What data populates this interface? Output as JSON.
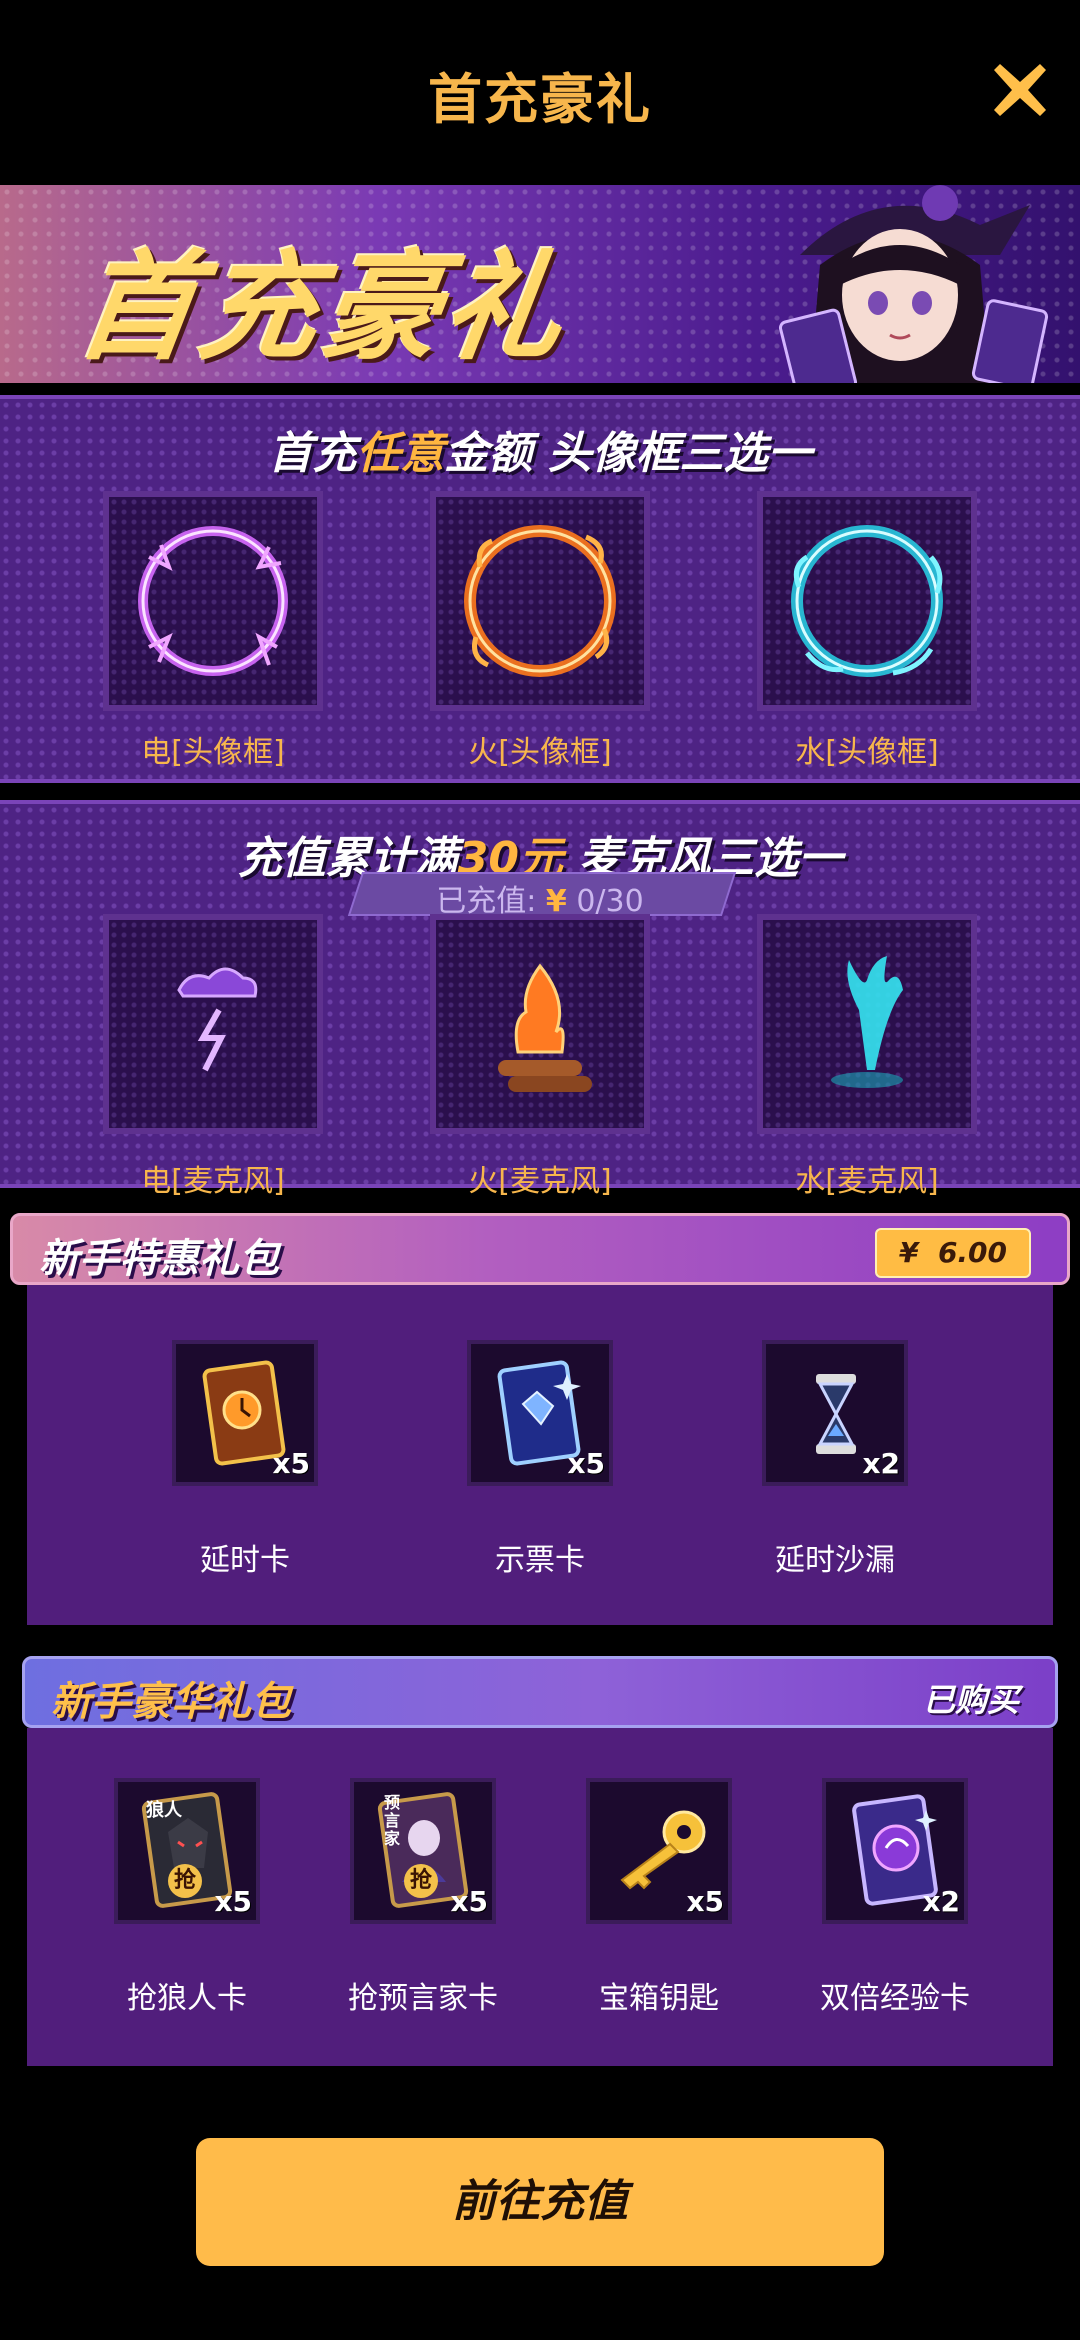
{
  "header": {
    "title": "首充豪礼"
  },
  "banner": {
    "title": "首充豪礼"
  },
  "section1": {
    "title_pre": "首充",
    "title_hl": "任意",
    "title_post": "金额  头像框三选一",
    "items": [
      {
        "label": "电[头像框]",
        "color": "#d76bff"
      },
      {
        "label": "火[头像框]",
        "color": "#ff9a3a"
      },
      {
        "label": "水[头像框]",
        "color": "#4fe3f0"
      }
    ]
  },
  "section2": {
    "title_pre": "充值累计满",
    "title_hl": "30元",
    "title_post": "  麦克风三选一",
    "paid_label": "已充值:",
    "paid_currency": "¥",
    "paid_value": "0/30",
    "items": [
      {
        "label": "电[麦克风]",
        "color": "#b06cff"
      },
      {
        "label": "火[麦克风]",
        "color": "#ff7a22"
      },
      {
        "label": "水[麦克风]",
        "color": "#35e6f2"
      }
    ]
  },
  "pack1": {
    "title": "新手特惠礼包",
    "price_currency": "¥",
    "price": "6.00",
    "items": [
      {
        "label": "延时卡",
        "qty": "x5",
        "icon": "delay-card-icon"
      },
      {
        "label": "示票卡",
        "qty": "x5",
        "icon": "vote-card-icon"
      },
      {
        "label": "延时沙漏",
        "qty": "x2",
        "icon": "hourglass-icon"
      }
    ]
  },
  "pack2": {
    "title": "新手豪华礼包",
    "status": "已购买",
    "items": [
      {
        "label": "抢狼人卡",
        "qty": "x5",
        "icon": "werewolf-card-icon",
        "card_text": "狼人",
        "badge": "抢"
      },
      {
        "label": "抢预言家卡",
        "qty": "x5",
        "icon": "seer-card-icon",
        "card_text": "预言家",
        "badge": "抢"
      },
      {
        "label": "宝箱钥匙",
        "qty": "x5",
        "icon": "key-icon"
      },
      {
        "label": "双倍经验卡",
        "qty": "x2",
        "icon": "double-exp-card-icon"
      }
    ]
  },
  "cta": {
    "label": "前往充值"
  },
  "colors": {
    "accent": "#ffbb4a",
    "panel": "#4e2384",
    "title": "#f7b64c"
  }
}
